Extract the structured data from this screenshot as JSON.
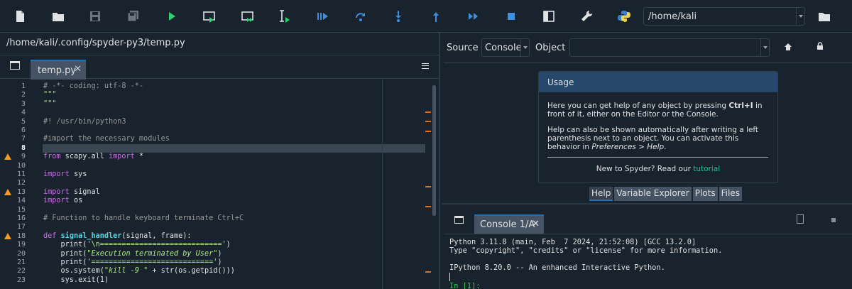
{
  "toolbar": {
    "buttons": [
      {
        "name": "new-file-icon"
      },
      {
        "name": "open-file-icon"
      },
      {
        "name": "save-icon"
      },
      {
        "name": "save-all-icon"
      },
      {
        "name": "run-icon"
      },
      {
        "name": "run-cell-icon"
      },
      {
        "name": "run-cell-advance-icon"
      },
      {
        "name": "run-selection-icon"
      },
      {
        "name": "debug-icon"
      },
      {
        "name": "step-icon"
      },
      {
        "name": "step-into-icon"
      },
      {
        "name": "step-return-icon"
      },
      {
        "name": "continue-icon"
      },
      {
        "name": "stop-icon"
      },
      {
        "name": "maximize-pane-icon"
      },
      {
        "name": "preferences-icon"
      },
      {
        "name": "python-path-icon"
      }
    ],
    "working_dir": "/home/kali",
    "colors": {
      "run": "#2fcf6f",
      "debug": "#3d8fe0",
      "disabled": "#6b7680"
    }
  },
  "editor": {
    "path": "/home/kali/.config/spyder-py3/temp.py",
    "tab_label": "temp.py",
    "current_line": 8,
    "warning_lines": [
      9,
      13,
      18
    ],
    "lines": [
      {
        "n": "1",
        "segs": [
          {
            "c": "c-comment",
            "t": "# -*- coding: utf-8 -*-"
          }
        ]
      },
      {
        "n": "2",
        "segs": [
          {
            "c": "c-str",
            "t": "\"\"\""
          }
        ]
      },
      {
        "n": "3",
        "segs": [
          {
            "c": "c-str",
            "t": "\"\"\""
          }
        ]
      },
      {
        "n": "4",
        "segs": []
      },
      {
        "n": "5",
        "segs": [
          {
            "c": "c-comment",
            "t": "#! /usr/bin/python3"
          }
        ]
      },
      {
        "n": "6",
        "segs": []
      },
      {
        "n": "7",
        "segs": [
          {
            "c": "c-comment",
            "t": "#import the necessary modules"
          }
        ]
      },
      {
        "n": "8",
        "segs": []
      },
      {
        "n": "9",
        "segs": [
          {
            "c": "c-kw",
            "t": "from"
          },
          {
            "c": "c-plain",
            "t": " scapy.all "
          },
          {
            "c": "c-kw",
            "t": "import"
          },
          {
            "c": "c-plain",
            "t": " *"
          }
        ]
      },
      {
        "n": "10",
        "segs": []
      },
      {
        "n": "11",
        "segs": [
          {
            "c": "c-kw",
            "t": "import"
          },
          {
            "c": "c-plain",
            "t": " sys"
          }
        ]
      },
      {
        "n": "12",
        "segs": []
      },
      {
        "n": "13",
        "segs": [
          {
            "c": "c-kw",
            "t": "import"
          },
          {
            "c": "c-plain",
            "t": " signal"
          }
        ]
      },
      {
        "n": "14",
        "segs": [
          {
            "c": "c-kw",
            "t": "import"
          },
          {
            "c": "c-plain",
            "t": " os"
          }
        ]
      },
      {
        "n": "15",
        "segs": []
      },
      {
        "n": "16",
        "segs": [
          {
            "c": "c-comment",
            "t": "# Function to handle keyboard terminate Ctrl+C"
          }
        ]
      },
      {
        "n": "17",
        "segs": []
      },
      {
        "n": "18",
        "segs": [
          {
            "c": "c-kw",
            "t": "def"
          },
          {
            "c": "c-plain",
            "t": " "
          },
          {
            "c": "c-def",
            "t": "signal_handler"
          },
          {
            "c": "c-plain",
            "t": "(signal, frame):"
          }
        ]
      },
      {
        "n": "19",
        "segs": [
          {
            "c": "c-plain",
            "t": "    print("
          },
          {
            "c": "c-str",
            "t": "'\\n============================'"
          },
          {
            "c": "c-plain",
            "t": ")"
          }
        ]
      },
      {
        "n": "20",
        "segs": [
          {
            "c": "c-plain",
            "t": "    print("
          },
          {
            "c": "c-str-i",
            "t": "\"Execution terminated by User\""
          },
          {
            "c": "c-plain",
            "t": ")"
          }
        ]
      },
      {
        "n": "21",
        "segs": [
          {
            "c": "c-plain",
            "t": "    print("
          },
          {
            "c": "c-str",
            "t": "'============================'"
          },
          {
            "c": "c-plain",
            "t": ")"
          }
        ]
      },
      {
        "n": "22",
        "segs": [
          {
            "c": "c-plain",
            "t": "    os.system("
          },
          {
            "c": "c-str-i",
            "t": "\"kill -9 \""
          },
          {
            "c": "c-plain",
            "t": " + str(os.getpid()))"
          }
        ]
      },
      {
        "n": "23",
        "segs": [
          {
            "c": "c-plain",
            "t": "    sys.exit(1)"
          }
        ]
      }
    ]
  },
  "help": {
    "source_label": "Source",
    "source_value": "Console",
    "object_label": "Object",
    "object_value": "",
    "usage_title": "Usage",
    "p1_a": "Here you can get help of any object by pressing ",
    "p1_b": "Ctrl+I",
    "p1_c": " in front of it, either on the Editor or the Console.",
    "p2_a": "Help can also be shown automatically after writing a left parenthesis next to an object. You can activate this behavior in ",
    "p2_b": "Preferences > Help",
    "p2_c": ".",
    "new_text": "New to Spyder? Read our ",
    "tutorial": "tutorial",
    "tabs": [
      "Help",
      "Variable Explorer",
      "Plots",
      "Files"
    ]
  },
  "console": {
    "tab_label": "Console 1/A",
    "lines": [
      "Python 3.11.8 (main, Feb  7 2024, 21:52:08) [GCC 13.2.0]",
      "Type \"copyright\", \"credits\" or \"license\" for more information.",
      "",
      "IPython 8.20.0 -- An enhanced Interactive Python."
    ],
    "prompt": "In [1]:"
  }
}
